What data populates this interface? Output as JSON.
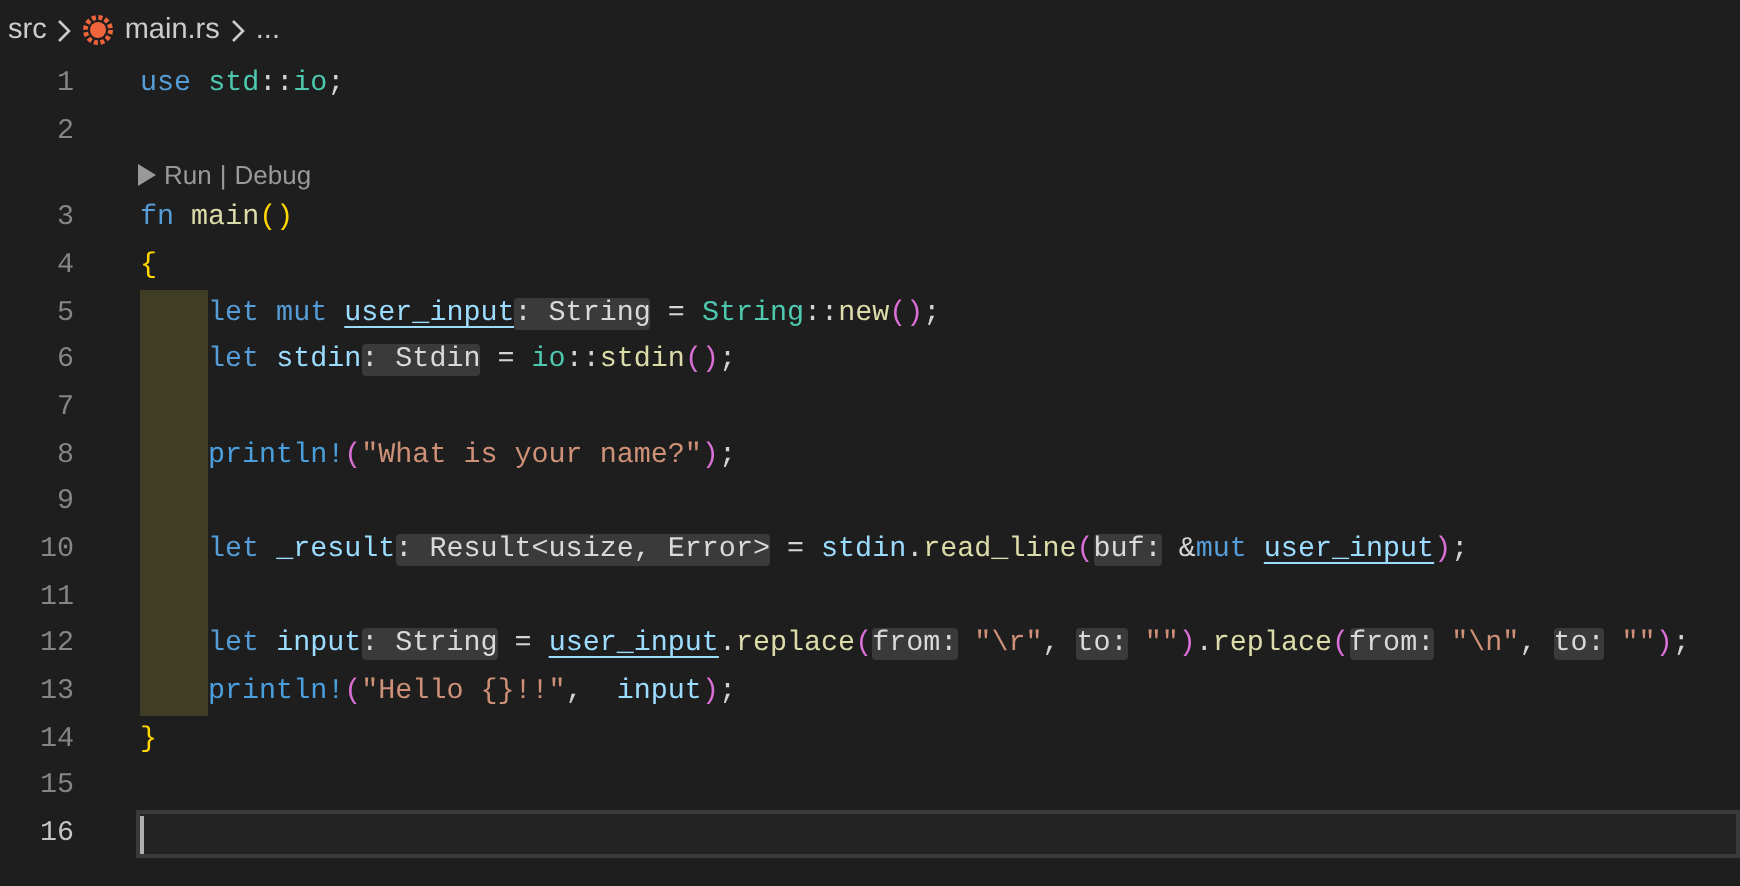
{
  "breadcrumb": [
    {
      "label": "src",
      "kind": "folder"
    },
    {
      "label": "main.rs",
      "kind": "file"
    },
    {
      "label": "...",
      "kind": "more"
    }
  ],
  "lines": [
    {
      "number": "1",
      "indented": false,
      "current": false,
      "tokens": [
        {
          "kind": "kw",
          "text": "use "
        },
        {
          "kind": "ns",
          "text": "std"
        },
        {
          "kind": "p",
          "text": "::"
        },
        {
          "kind": "ns",
          "text": "io"
        },
        {
          "kind": "p",
          "text": ";"
        }
      ]
    },
    {
      "number": "2",
      "indented": false,
      "current": false
    },
    {
      "number": "3",
      "indented": false,
      "current": false,
      "codelens": {
        "actions": [
          "Run",
          "Debug"
        ],
        "separator": "|"
      },
      "tokens": [
        {
          "kind": "kw",
          "text": "fn "
        },
        {
          "kind": "fn",
          "text": "main"
        },
        {
          "kind": "b1",
          "text": "()"
        }
      ]
    },
    {
      "number": "4",
      "indented": false,
      "current": false,
      "tokens": [
        {
          "kind": "b1",
          "text": "{"
        }
      ]
    },
    {
      "number": "5",
      "indented": true,
      "current": false,
      "tokens": [
        {
          "kind": "kw",
          "text": "let mut "
        },
        {
          "kind": "mutvar",
          "text": "user_input"
        },
        {
          "kind": "hint",
          "text": ": String"
        },
        {
          "kind": "p",
          "text": " = "
        },
        {
          "kind": "ns",
          "text": "String"
        },
        {
          "kind": "p",
          "text": "::"
        },
        {
          "kind": "fn",
          "text": "new"
        },
        {
          "kind": "b2",
          "text": "()"
        },
        {
          "kind": "p",
          "text": ";"
        }
      ]
    },
    {
      "number": "6",
      "indented": true,
      "current": false,
      "tokens": [
        {
          "kind": "kw",
          "text": "let "
        },
        {
          "kind": "var",
          "text": "stdin"
        },
        {
          "kind": "hint",
          "text": ": Stdin"
        },
        {
          "kind": "p",
          "text": " = "
        },
        {
          "kind": "ns",
          "text": "io"
        },
        {
          "kind": "p",
          "text": "::"
        },
        {
          "kind": "fn",
          "text": "stdin"
        },
        {
          "kind": "b2",
          "text": "()"
        },
        {
          "kind": "p",
          "text": ";"
        }
      ]
    },
    {
      "number": "7",
      "indented": true,
      "current": false
    },
    {
      "number": "8",
      "indented": true,
      "current": false,
      "tokens": [
        {
          "kind": "macro",
          "text": "println!"
        },
        {
          "kind": "b2",
          "text": "("
        },
        {
          "kind": "str",
          "text": "\"What is your name?\""
        },
        {
          "kind": "b2",
          "text": ")"
        },
        {
          "kind": "p",
          "text": ";"
        }
      ]
    },
    {
      "number": "9",
      "indented": true,
      "current": false
    },
    {
      "number": "10",
      "indented": true,
      "current": false,
      "tokens": [
        {
          "kind": "kw",
          "text": "let "
        },
        {
          "kind": "var",
          "text": "_result"
        },
        {
          "kind": "hint",
          "text": ": Result<usize, Error>"
        },
        {
          "kind": "p",
          "text": " = "
        },
        {
          "kind": "var",
          "text": "stdin"
        },
        {
          "kind": "p",
          "text": "."
        },
        {
          "kind": "fn",
          "text": "read_line"
        },
        {
          "kind": "b2",
          "text": "("
        },
        {
          "kind": "hint",
          "text": "buf:"
        },
        {
          "kind": "p",
          "text": " &"
        },
        {
          "kind": "kw",
          "text": "mut "
        },
        {
          "kind": "mutvar",
          "text": "user_input"
        },
        {
          "kind": "b2",
          "text": ")"
        },
        {
          "kind": "p",
          "text": ";"
        }
      ]
    },
    {
      "number": "11",
      "indented": true,
      "current": false
    },
    {
      "number": "12",
      "indented": true,
      "current": false,
      "tokens": [
        {
          "kind": "kw",
          "text": "let "
        },
        {
          "kind": "var",
          "text": "input"
        },
        {
          "kind": "hint",
          "text": ": String"
        },
        {
          "kind": "p",
          "text": " = "
        },
        {
          "kind": "mutvar",
          "text": "user_input"
        },
        {
          "kind": "p",
          "text": "."
        },
        {
          "kind": "fn",
          "text": "replace"
        },
        {
          "kind": "b2",
          "text": "("
        },
        {
          "kind": "hint",
          "text": "from:"
        },
        {
          "kind": "str",
          "text": " \"\\r\""
        },
        {
          "kind": "p",
          "text": ", "
        },
        {
          "kind": "hint",
          "text": "to:"
        },
        {
          "kind": "str",
          "text": " \"\""
        },
        {
          "kind": "b2",
          "text": ")"
        },
        {
          "kind": "p",
          "text": "."
        },
        {
          "kind": "fn",
          "text": "replace"
        },
        {
          "kind": "b2",
          "text": "("
        },
        {
          "kind": "hint",
          "text": "from:"
        },
        {
          "kind": "str",
          "text": " \"\\n\""
        },
        {
          "kind": "p",
          "text": ", "
        },
        {
          "kind": "hint",
          "text": "to:"
        },
        {
          "kind": "str",
          "text": " \"\""
        },
        {
          "kind": "b2",
          "text": ")"
        },
        {
          "kind": "p",
          "text": ";"
        }
      ]
    },
    {
      "number": "13",
      "indented": true,
      "current": false,
      "tokens": [
        {
          "kind": "macro",
          "text": "println!"
        },
        {
          "kind": "b2",
          "text": "("
        },
        {
          "kind": "str",
          "text": "\"Hello {}!!\""
        },
        {
          "kind": "p",
          "text": ",  "
        },
        {
          "kind": "var",
          "text": "input"
        },
        {
          "kind": "b2",
          "text": ")"
        },
        {
          "kind": "p",
          "text": ";"
        }
      ]
    },
    {
      "number": "14",
      "indented": false,
      "current": false,
      "tokens": [
        {
          "kind": "b1",
          "text": "}"
        }
      ]
    },
    {
      "number": "15",
      "indented": false,
      "current": false
    },
    {
      "number": "16",
      "indented": false,
      "current": true
    }
  ]
}
